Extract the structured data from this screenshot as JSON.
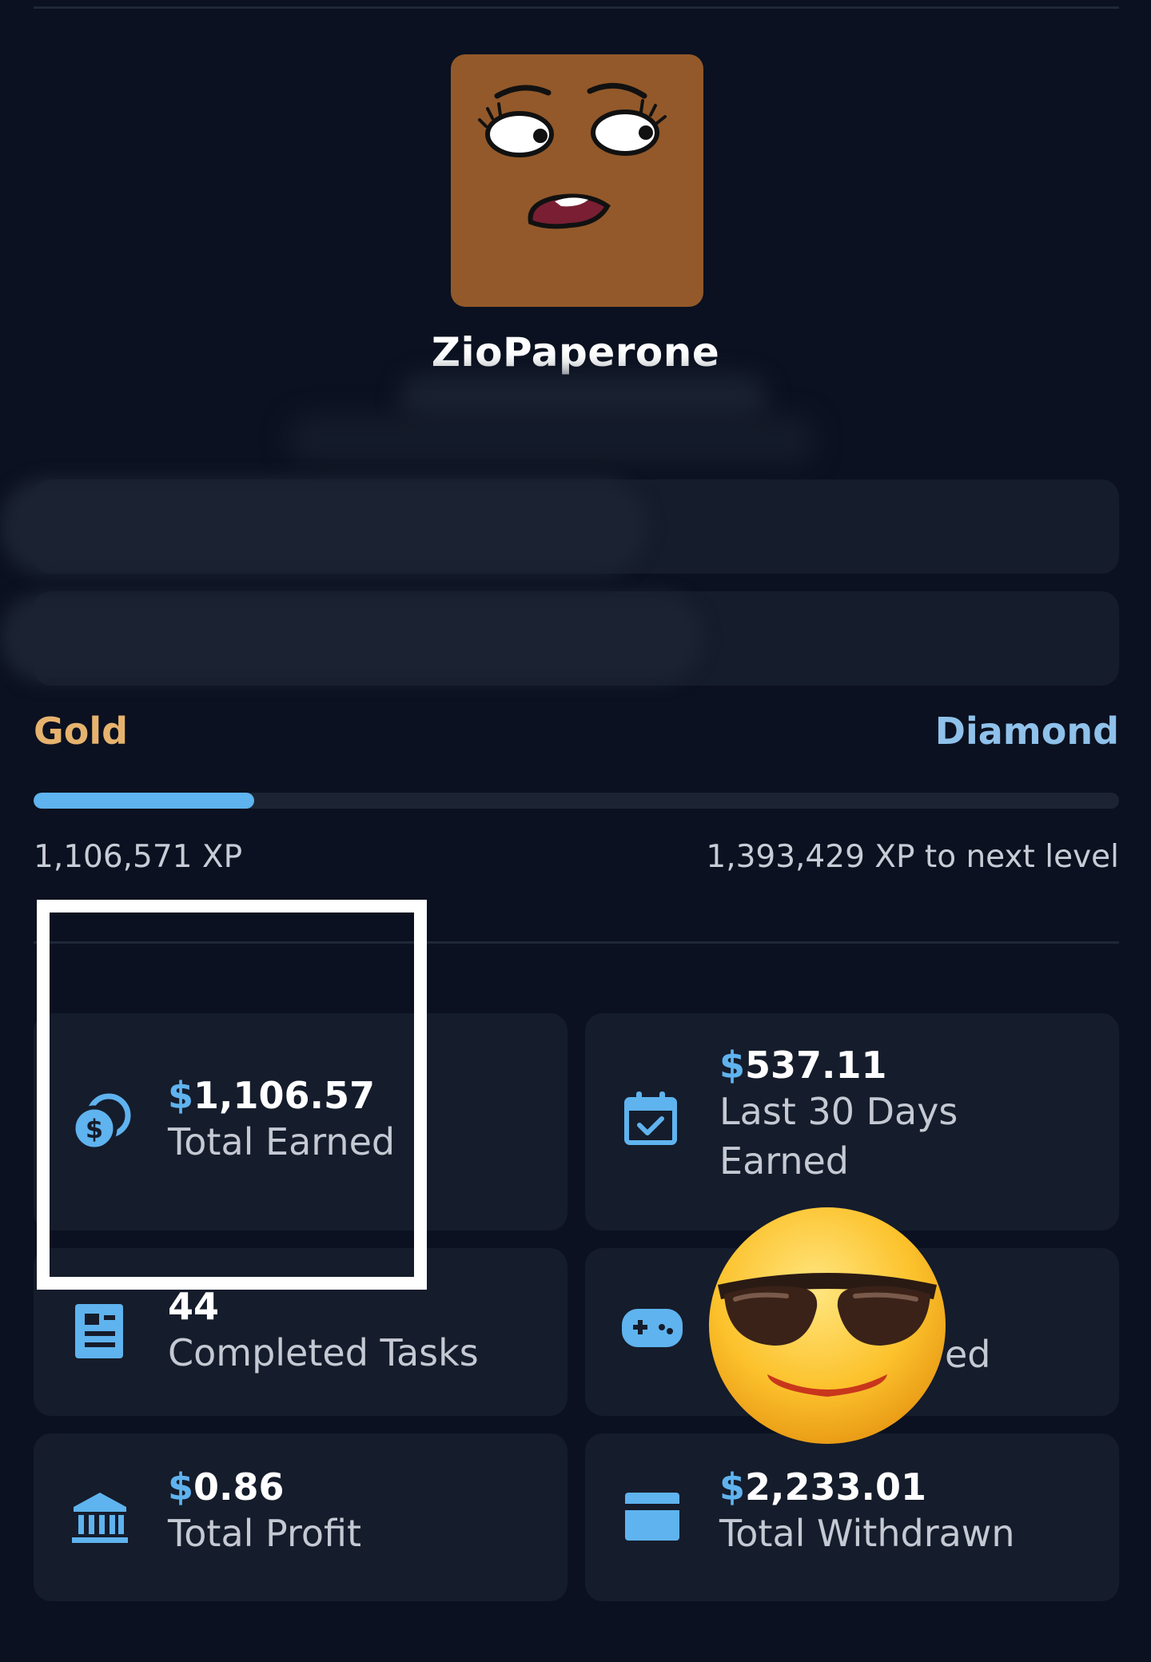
{
  "profile": {
    "username": "ZioPaperone",
    "avatar_icon": "cartoon-face-avatar-icon"
  },
  "level": {
    "current_rank": "Gold",
    "next_rank": "Diamond",
    "progress": 0.203,
    "current_xp": "1,106,571 XP",
    "xp_to_next": "1,393,429 XP to next level"
  },
  "stats": {
    "total_earned": {
      "currency": "$",
      "value": "1,106.57",
      "label": "Total Earned",
      "icon": "coins-icon"
    },
    "last_30_days": {
      "currency": "$",
      "value": "537.11",
      "label_line1": "Last 30 Days",
      "label_line2": "Earned",
      "icon": "calendar-check-icon"
    },
    "completed_tasks": {
      "value": "44",
      "label": "Completed Tasks",
      "icon": "clipboard-icon"
    },
    "games_played": {
      "label_fragment": "ed",
      "icon": "gamepad-icon"
    },
    "total_profit": {
      "currency": "$",
      "value": "0.86",
      "label": "Total Profit",
      "icon": "bank-icon"
    },
    "total_withdrawn": {
      "currency": "$",
      "value": "2,233.01",
      "label": "Total Withdrawn",
      "icon": "credit-card-icon"
    }
  },
  "colors": {
    "background": "#0b1120",
    "card": "#151c2b",
    "accent_blue": "#5fb3ee",
    "gold": "#e6b36e",
    "diamond": "#8fc1ea"
  },
  "overlay": {
    "emoji": "sunglasses-emoji-icon"
  }
}
